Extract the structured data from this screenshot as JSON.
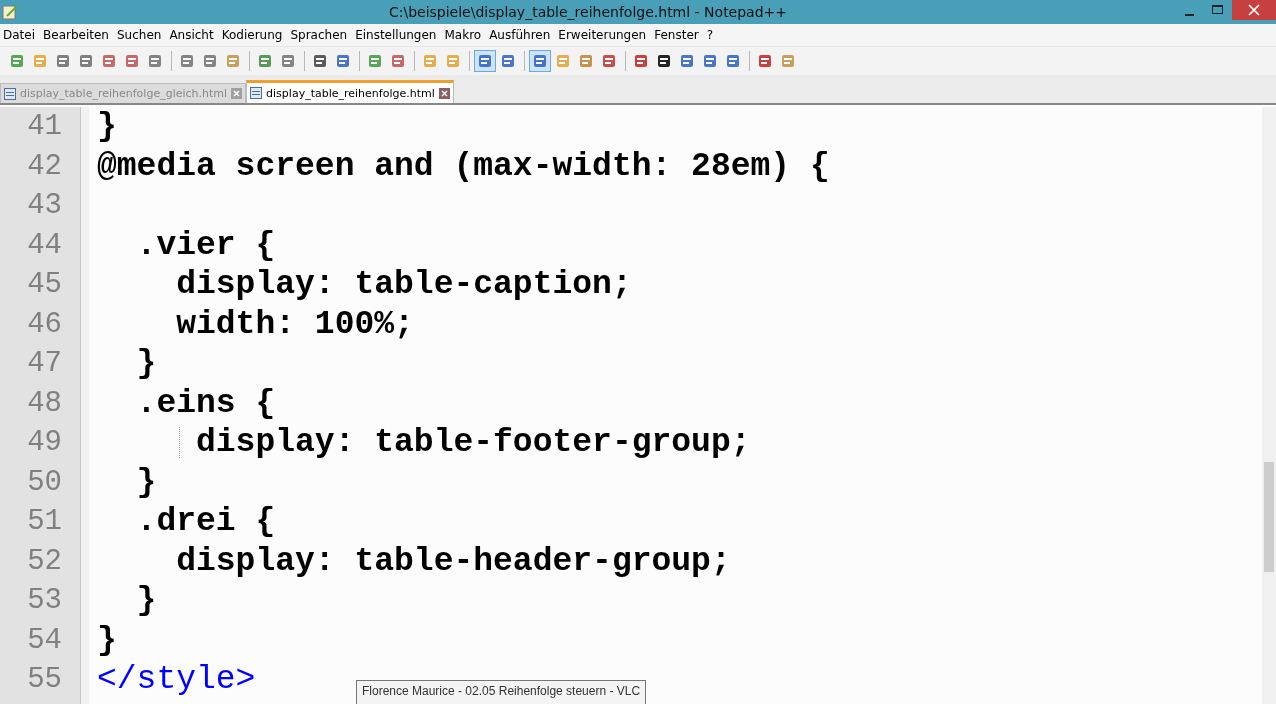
{
  "window": {
    "title": "C:\\beispiele\\display_table_reihenfolge.html - Notepad++"
  },
  "menu": [
    "Datei",
    "Bearbeiten",
    "Suchen",
    "Ansicht",
    "Kodierung",
    "Sprachen",
    "Einstellungen",
    "Makro",
    "Ausführen",
    "Erweiterungen",
    "Fenster",
    "?"
  ],
  "toolbar": {
    "wrap_pressed": true,
    "indent_guide_pressed": true
  },
  "tabs": [
    {
      "label": "display_table_reihenfolge_gleich.html",
      "selected": false
    },
    {
      "label": "display_table_reihenfolge.html",
      "selected": true
    }
  ],
  "editor": {
    "lines": [
      {
        "number": "41",
        "text": "}",
        "kind": "css",
        "guide": false
      },
      {
        "number": "42",
        "text": "@media screen and (max-width: 28em) {",
        "kind": "css",
        "guide": false
      },
      {
        "number": "43",
        "guide": false
      },
      {
        "number": "44",
        "text": "  .vier {",
        "kind": "css",
        "guide": false
      },
      {
        "number": "45",
        "text": "    display: table-caption;",
        "kind": "css",
        "guide": false
      },
      {
        "number": "46",
        "text": "    width: 100%;",
        "kind": "css",
        "guide": false
      },
      {
        "number": "47",
        "text": "  }",
        "kind": "css",
        "guide": false
      },
      {
        "number": "48",
        "text": "  .eins {",
        "kind": "css",
        "guide": false
      },
      {
        "number": "49",
        "text": "     display: table-footer-group;",
        "kind": "css",
        "guide": true
      },
      {
        "number": "50",
        "text": "  }",
        "kind": "css",
        "guide": false
      },
      {
        "number": "51",
        "text": "  .drei {",
        "kind": "css",
        "guide": false
      },
      {
        "number": "52",
        "text": "    display: table-header-group;",
        "kind": "css",
        "guide": false
      },
      {
        "number": "53",
        "text": "  }",
        "kind": "css",
        "guide": false
      },
      {
        "number": "54",
        "text": "}",
        "kind": "css",
        "guide": false
      },
      {
        "number": "55",
        "text": "</style>",
        "kind": "tag",
        "guide": false
      }
    ]
  },
  "tooltip": {
    "text": "Florence Maurice - 02.05 Reihenfolge steuern - VLC"
  }
}
